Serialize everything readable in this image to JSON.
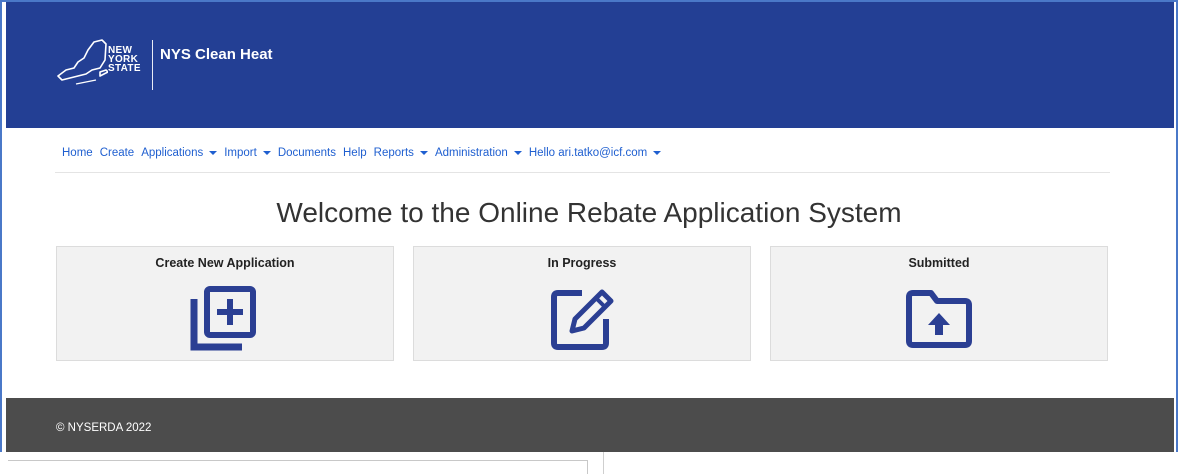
{
  "header": {
    "logo_lines": [
      "NEW",
      "YORK",
      "STATE"
    ],
    "app_title": "NYS Clean Heat",
    "bg_color": "#233f94"
  },
  "nav": {
    "items": [
      {
        "label": "Home",
        "dropdown": false
      },
      {
        "label": "Create",
        "dropdown": false
      },
      {
        "label": "Applications",
        "dropdown": true
      },
      {
        "label": "Import",
        "dropdown": true
      },
      {
        "label": "Documents",
        "dropdown": false
      },
      {
        "label": "Help",
        "dropdown": false
      },
      {
        "label": "Reports",
        "dropdown": true
      },
      {
        "label": "Administration",
        "dropdown": true
      },
      {
        "label": "Hello ari.tatko@icf.com",
        "dropdown": true
      }
    ],
    "link_color": "#1f5fd0"
  },
  "main": {
    "welcome": "Welcome to the Online Rebate Application System",
    "cards": [
      {
        "title": "Create New Application",
        "icon": "add-copy-icon"
      },
      {
        "title": "In Progress",
        "icon": "edit-icon"
      },
      {
        "title": "Submitted",
        "icon": "folder-upload-icon"
      }
    ],
    "icon_color": "#2b3f93"
  },
  "footer": {
    "text": "© NYSERDA 2022",
    "bg_color": "#4c4c4c"
  }
}
